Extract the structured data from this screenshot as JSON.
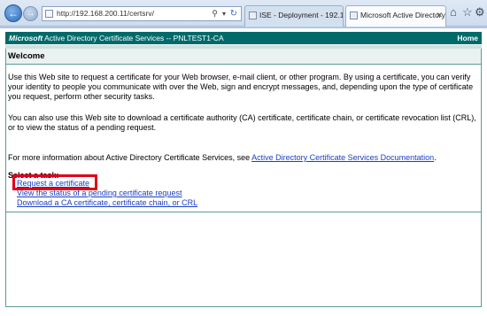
{
  "browser": {
    "address_url": "http://192.168.200.11/certsrv/",
    "tabs": [
      {
        "label": "ISE - Deployment - 192.168.20..."
      },
      {
        "label": "Microsoft Active Directory ..."
      }
    ],
    "icons": [
      "back-icon",
      "forward-icon",
      "search-icon",
      "refresh-icon",
      "home-icon",
      "star-icon",
      "gear-icon"
    ]
  },
  "banner": {
    "brand": "Microsoft",
    "title": " Active Directory Certificate Services  --  PNLTEST1-CA",
    "home": "Home"
  },
  "page": {
    "heading": "Welcome",
    "paragraph1": "Use this Web site to request a certificate for your Web browser, e-mail client, or other program. By using a certificate, you can verify your identity to people you communicate with over the Web, sign and encrypt messages, and, depending upon the type of certificate you request, perform other security tasks.",
    "paragraph2": "You can also use this Web site to download a certificate authority (CA) certificate, certificate chain, or certificate revocation list (CRL), or to view the status of a pending request.",
    "paragraph3_prefix": "For more information about Active Directory Certificate Services, see ",
    "paragraph3_link": "Active Directory Certificate Services Documentation",
    "paragraph3_suffix": ".",
    "select_task_label": "Select a task:",
    "tasks": [
      "Request a certificate",
      "View the status of a pending certificate request",
      "Download a CA certificate, certificate chain, or CRL"
    ]
  },
  "colors": {
    "banner": "#006a6a",
    "link": "#1a3fc4",
    "highlight": "#e0001a"
  }
}
